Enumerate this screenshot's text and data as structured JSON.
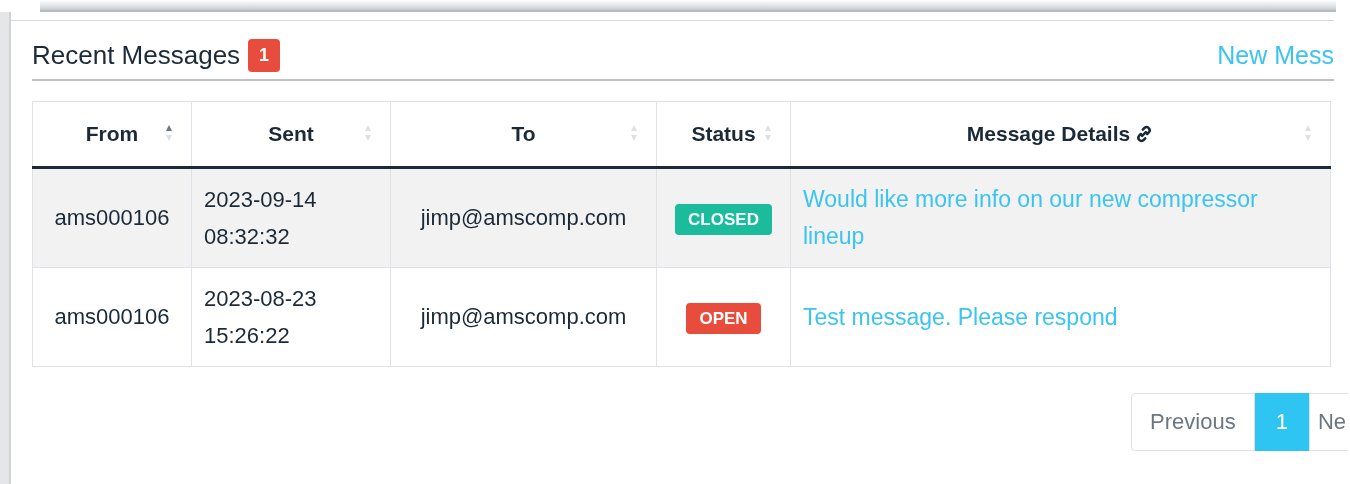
{
  "panel": {
    "title": "Recent Messages",
    "unread_count": "1",
    "new_message_link": "New Mess"
  },
  "table": {
    "columns": [
      {
        "label": "From",
        "sorted_ascending": true
      },
      {
        "label": "Sent",
        "sorted_ascending": false
      },
      {
        "label": "To",
        "sorted_ascending": false
      },
      {
        "label": "Status",
        "sorted_ascending": false
      },
      {
        "label": "Message Details",
        "sorted_ascending": false,
        "link_icon": true
      }
    ],
    "rows": [
      {
        "from": "ams000106",
        "sent_date": "2023-09-14",
        "sent_time": "08:32:32",
        "to": "jimp@amscomp.com",
        "status": "CLOSED",
        "color": "#1abc9c",
        "details": "Would like more info on our new compressor lineup",
        "selected": true
      },
      {
        "from": "ams000106",
        "sent_date": "2023-08-23",
        "sent_time": "15:26:22",
        "to": "jimp@amscomp.com",
        "status": "OPEN",
        "color": "#e74c3c",
        "details": "Test message. Please respond",
        "selected": false
      }
    ]
  },
  "pagination": {
    "previous": "Previous",
    "pages": [
      {
        "label": "1",
        "selected": true
      }
    ],
    "next": "Ne"
  }
}
